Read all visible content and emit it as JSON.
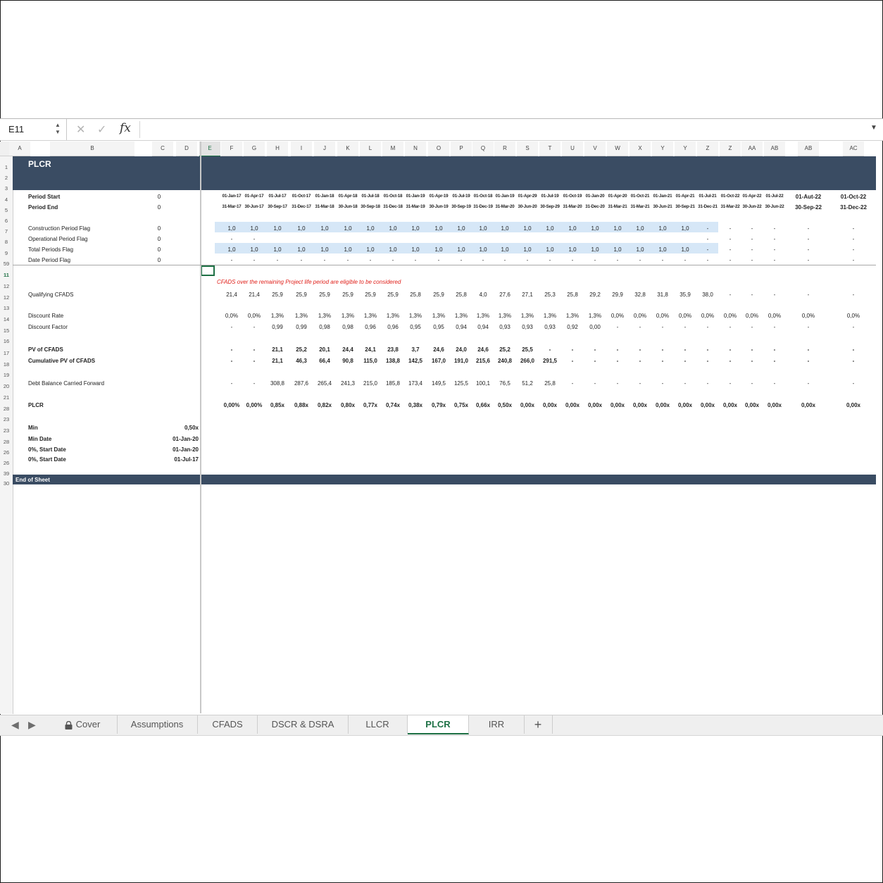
{
  "formula_bar": {
    "cell_ref": "E11",
    "cancel_icon": "✕",
    "enter_icon": "✓",
    "fx": "fx"
  },
  "sheet": {
    "title": "PLCR",
    "columns": [
      "A",
      "B",
      "C",
      "D",
      "E",
      "F",
      "G",
      "H",
      "I",
      "J",
      "K",
      "L",
      "M",
      "N",
      "O",
      "P",
      "Q",
      "R",
      "S",
      "T",
      "U",
      "V",
      "W",
      "X",
      "Y",
      "Y",
      "Z",
      "Z",
      "AA",
      "AB",
      "AB",
      "AC"
    ],
    "selected_column": "E",
    "row_numbers": [
      "1",
      "2",
      "3",
      "4",
      "5",
      "6",
      "7",
      "8",
      "9",
      "59",
      "11",
      "12",
      "12",
      "13",
      "14",
      "15",
      "16",
      "17",
      "18",
      "19",
      "20",
      "21",
      "28",
      "23",
      "23",
      "28",
      "26",
      "26",
      "39",
      "30"
    ],
    "selected_row": "11",
    "note": "CFADS over the remaining Project life period are eligible to be considered",
    "end_label": "End of Sheet",
    "period_start": {
      "label": "Period Start",
      "c": "0",
      "values": [
        "01-Jan-17",
        "01-Apr-17",
        "01-Jul-17",
        "01-Oct-17",
        "01-Jan-18",
        "01-Apr-18",
        "01-Jul-18",
        "01-Oct-18",
        "01-Jan-19",
        "01-Apr-19",
        "01-Jul-19",
        "01-Oct-18",
        "01-Jan-19",
        "01-Apr-29",
        "01-Jul-19",
        "01-Oct-19",
        "01-Jan-20",
        "01-Apr-20",
        "01-Oct-21",
        "01-Jan-21",
        "01-Apr-21",
        "01-Jul-21",
        "01-Oct-22",
        "01-Apr-22",
        "01-Jul-22",
        "01-Aut-22",
        "01-Oct-22"
      ]
    },
    "period_end": {
      "label": "Period End",
      "c": "0",
      "values": [
        "31-Mar-17",
        "30-Jun-17",
        "30-Sep-17",
        "31-Dec-17",
        "31-Mar-18",
        "30-Jun-18",
        "30-Sep-18",
        "31-Dec-18",
        "31-Mar-19",
        "30-Jun-19",
        "30-Sep-19",
        "31-Dec-19",
        "31-Mar-20",
        "30-Jun-20",
        "30-Sep-29",
        "31-Mar-20",
        "31-Dec-20",
        "31-Mar-21",
        "31-Mar-21",
        "30-Jun-21",
        "30-Sep-21",
        "31-Dec-21",
        "31-Mar-22",
        "30-Jun-22",
        "30-Jun-22",
        "30-Sep-22",
        "31-Dec-22"
      ]
    },
    "construction_flag": {
      "label": "Construction Period Flag",
      "c": "0",
      "values": [
        "1,0",
        "1,0",
        "1,0",
        "1,0",
        "1,0",
        "1,0",
        "1,0",
        "1,0",
        "1,0",
        "1,0",
        "1,0",
        "1,0",
        "1,0",
        "1,0",
        "1,0",
        "1,0",
        "1,0",
        "1,0",
        "1,0",
        "1,0",
        "1,0",
        "-",
        "-",
        "-",
        "-",
        "-",
        "-"
      ]
    },
    "operational_flag": {
      "label": "Operational Period Flag",
      "c": "0",
      "values": [
        "-",
        "-",
        "",
        "",
        "",
        "",
        "",
        "",
        "",
        "",
        "",
        "",
        "",
        "",
        "",
        "",
        "",
        "",
        "",
        "",
        "",
        "-",
        "-",
        "-",
        "-",
        "-",
        "-"
      ]
    },
    "total_flag": {
      "label": "Total Periods Flag",
      "c": "0",
      "values": [
        "1,0",
        "1,0",
        "1,0",
        "1,0",
        "1,0",
        "1,0",
        "1,0",
        "1,0",
        "1,0",
        "1,0",
        "1,0",
        "1,0",
        "1,0",
        "1,0",
        "1,0",
        "1,0",
        "1,0",
        "1,0",
        "1,0",
        "1,0",
        "1,0",
        "-",
        "-",
        "-",
        "-",
        "-",
        "-"
      ]
    },
    "date_flag": {
      "label": "Date Period Flag",
      "c": "0",
      "values": [
        "-",
        "-",
        "-",
        "-",
        "-",
        "-",
        "-",
        "-",
        "-",
        "-",
        "-",
        "-",
        "-",
        "-",
        "-",
        "-",
        "-",
        "-",
        "-",
        "-",
        "-",
        "-",
        "-",
        "-",
        "-",
        "-",
        "-"
      ]
    },
    "qualifying_cfads": {
      "label": "Qualifying CFADS",
      "values": [
        "21,4",
        "21,4",
        "25,9",
        "25,9",
        "25,9",
        "25,9",
        "25,9",
        "25,9",
        "25,8",
        "25,9",
        "25,8",
        "4,0",
        "27,6",
        "27,1",
        "25,3",
        "25,8",
        "29,2",
        "29,9",
        "32,8",
        "31,8",
        "35,9",
        "38,0",
        "-",
        "-",
        "-",
        "-",
        "-"
      ]
    },
    "discount_rate": {
      "label": "Discount Rate",
      "values": [
        "0,0%",
        "0,0%",
        "1,3%",
        "1,3%",
        "1,3%",
        "1,3%",
        "1,3%",
        "1,3%",
        "1,3%",
        "1,3%",
        "1,3%",
        "1,3%",
        "1,3%",
        "1,3%",
        "1,3%",
        "1,3%",
        "1,3%",
        "0,0%",
        "0,0%",
        "0,0%",
        "0,0%",
        "0,0%",
        "0,0%",
        "0,0%",
        "0,0%",
        "0,0%",
        "0,0%"
      ]
    },
    "discount_factor": {
      "label": "Discount Factor",
      "values": [
        "-",
        "-",
        "0,99",
        "0,99",
        "0,98",
        "0,98",
        "0,96",
        "0,96",
        "0,95",
        "0,95",
        "0,94",
        "0,94",
        "0,93",
        "0,93",
        "0,93",
        "0,92",
        "0,00",
        "-",
        "-",
        "-",
        "-",
        "-",
        "-",
        "-",
        "-",
        "-",
        "-"
      ]
    },
    "pv_cfads": {
      "label": "PV of CFADS",
      "values": [
        "-",
        "-",
        "21,1",
        "25,2",
        "20,1",
        "24,4",
        "24,1",
        "23,8",
        "3,7",
        "24,6",
        "24,0",
        "24,6",
        "25,2",
        "25,5",
        "-",
        "-",
        "-",
        "-",
        "-",
        "-",
        "-",
        "-",
        "-",
        "-",
        "-",
        "-",
        "-"
      ]
    },
    "cum_pv_cfads": {
      "label": "Cumulative PV of CFADS",
      "values": [
        "-",
        "-",
        "21,1",
        "46,3",
        "66,4",
        "90,8",
        "115,0",
        "138,8",
        "142,5",
        "167,0",
        "191,0",
        "215,6",
        "240,8",
        "266,0",
        "291,5",
        "-",
        "-",
        "-",
        "-",
        "-",
        "-",
        "-",
        "-",
        "-",
        "-",
        "-",
        "-"
      ]
    },
    "debt_balance": {
      "label": "Debt Balance Carried Forward",
      "values": [
        "-",
        "-",
        "308,8",
        "287,6",
        "265,4",
        "241,3",
        "215,0",
        "185,8",
        "173,4",
        "149,5",
        "125,5",
        "100,1",
        "76,5",
        "51,2",
        "25,8",
        "-",
        "-",
        "-",
        "-",
        "-",
        "-",
        "-",
        "-",
        "-",
        "-",
        "-",
        "-"
      ]
    },
    "plcr": {
      "label": "PLCR",
      "values": [
        "0,00%",
        "0,00%",
        "0,85x",
        "0,88x",
        "0,82x",
        "0,80x",
        "0,77x",
        "0,74x",
        "0,38x",
        "0,79x",
        "0,75x",
        "0,66x",
        "0,50x",
        "0,00x",
        "0,00x",
        "0,00x",
        "0,00x",
        "0,00x",
        "0,00x",
        "0,00x",
        "0,00x",
        "0,00x",
        "0,00x",
        "0,00x",
        "0,00x",
        "0,00x",
        "0,00x"
      ]
    },
    "summary": [
      {
        "label": "Min",
        "value": "0,50x"
      },
      {
        "label": "Min Date",
        "value": "01-Jan-20"
      },
      {
        "label": "0%, Start Date",
        "value": "01-Jan-20"
      },
      {
        "label": "0%, Start Date",
        "value": "01-Jul-17"
      }
    ]
  },
  "sheet_tabs": {
    "items": [
      "Cover",
      "Assumptions",
      "CFADS",
      "DSCR & DSRA",
      "LLCR",
      "PLCR",
      "IRR"
    ],
    "active": "PLCR",
    "add_label": "+"
  }
}
